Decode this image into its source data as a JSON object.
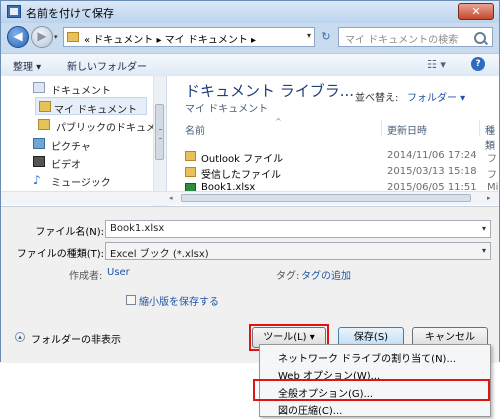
{
  "window": {
    "title": "名前を付けて保存",
    "close_label": "✕"
  },
  "nav": {
    "back_glyph": "◀",
    "forward_glyph": "▶",
    "history_glyph": "▾",
    "refresh_glyph": "↻"
  },
  "address": {
    "path": "« ドキュメント ▸ マイ ドキュメント ▸",
    "drop_glyph": "▾"
  },
  "search": {
    "placeholder": "マイ ドキュメントの検索"
  },
  "toolbar": {
    "organize_label": "整理 ▾",
    "new_folder_label": "新しいフォルダー",
    "views_glyph": "☷ ▾",
    "help_glyph": "?"
  },
  "nav_pane": {
    "items": [
      {
        "label": "ドキュメント",
        "icon": "library-icon"
      },
      {
        "label": "マイ ドキュメント",
        "icon": "folder-icon"
      },
      {
        "label": "パブリックのドキュメント",
        "icon": "folder-icon"
      },
      {
        "label": "ピクチャ",
        "icon": "picture-icon"
      },
      {
        "label": "ビデオ",
        "icon": "video-icon"
      },
      {
        "label": "ミュージック",
        "icon": "music-icon"
      }
    ],
    "music_glyph": "♪"
  },
  "library": {
    "title": "ドキュメント ライブラ...",
    "subtitle": "マイ ドキュメント",
    "arrange_label": "並べ替え:",
    "arrange_value": "フォルダー ▾"
  },
  "columns": {
    "name": "名前",
    "date": "更新日時",
    "type": "種類",
    "sort_glyph": "^"
  },
  "files": [
    {
      "name": "Outlook ファイル",
      "date": "2014/11/06 17:24",
      "type": "フ",
      "icon": "folder-icon"
    },
    {
      "name": "受信したファイル",
      "date": "2015/03/13 15:18",
      "type": "フ",
      "icon": "folder-icon"
    },
    {
      "name": "Book1.xlsx",
      "date": "2015/06/05 11:51",
      "type": "Mi",
      "icon": "excel-file-icon"
    }
  ],
  "scrollbar": {
    "left_glyph": "◂",
    "right_glyph": "▸"
  },
  "form": {
    "filename_label": "ファイル名(N):",
    "filename_value": "Book1.xlsx",
    "filetype_label": "ファイルの種類(T):",
    "filetype_value": "Excel ブック (*.xlsx)",
    "drop_glyph": "▾",
    "author_label": "作成者:",
    "author_value": "User",
    "tags_label": "タグ:",
    "tags_value": "タグの追加",
    "thumbnail_label": "縮小版を保存する",
    "hide_folders_glyph": "▴",
    "hide_folders_label": "フォルダーの非表示"
  },
  "buttons": {
    "tools": "ツール(L) ▾",
    "save": "保存(S)",
    "cancel": "キャンセル"
  },
  "tools_menu": {
    "items": [
      "ネットワーク ドライブの割り当て(N)...",
      "Web オプション(W)...",
      "全般オプション(G)...",
      "図の圧縮(C)..."
    ]
  },
  "colors": {
    "highlight": "#e2140f",
    "link": "#1e55a6"
  }
}
